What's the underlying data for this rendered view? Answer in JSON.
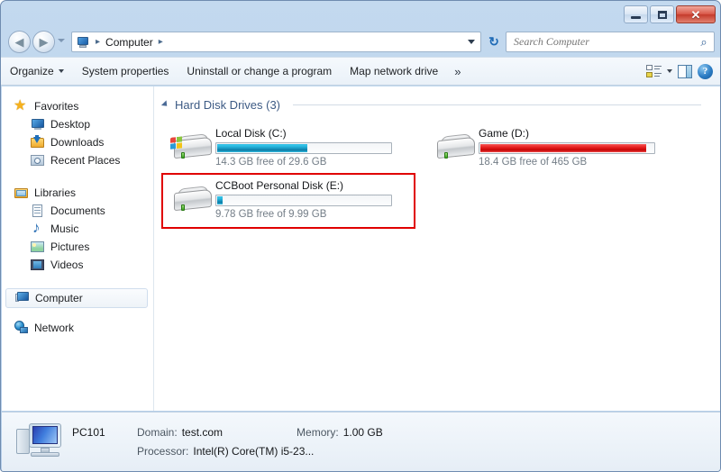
{
  "window": {
    "buttons": {
      "minimize": "minimize",
      "maximize": "maximize",
      "close": "✕"
    }
  },
  "nav_bar": {
    "back": "◀",
    "forward": "▶",
    "refresh": "↻",
    "breadcrumb": {
      "root": "Computer",
      "separator": "▸"
    },
    "search": {
      "placeholder": "Search Computer",
      "value": "",
      "icon": "⌕"
    }
  },
  "toolbar": {
    "items": [
      {
        "label": "Organize",
        "has_caret": true
      },
      {
        "label": "System properties",
        "has_caret": false
      },
      {
        "label": "Uninstall or change a program",
        "has_caret": false
      },
      {
        "label": "Map network drive",
        "has_caret": false
      }
    ],
    "overflow": "»",
    "help_glyph": "?"
  },
  "sidebar": {
    "groups": [
      {
        "header": {
          "label": "Favorites",
          "icon": "star-icon"
        },
        "items": [
          {
            "label": "Desktop",
            "icon": "desktop-icon"
          },
          {
            "label": "Downloads",
            "icon": "downloads-icon"
          },
          {
            "label": "Recent Places",
            "icon": "recent-places-icon"
          }
        ]
      },
      {
        "header": {
          "label": "Libraries",
          "icon": "libraries-icon"
        },
        "items": [
          {
            "label": "Documents",
            "icon": "documents-icon"
          },
          {
            "label": "Music",
            "icon": "music-icon"
          },
          {
            "label": "Pictures",
            "icon": "pictures-icon"
          },
          {
            "label": "Videos",
            "icon": "videos-icon"
          }
        ]
      }
    ],
    "computer": {
      "label": "Computer",
      "icon": "computer-icon",
      "selected": true
    },
    "network": {
      "label": "Network",
      "icon": "network-icon",
      "selected": false
    }
  },
  "content": {
    "group_title": "Hard Disk Drives (3)",
    "drives": [
      {
        "name": "Local Disk (C:)",
        "free_text": "14.3 GB free of 29.6 GB",
        "used_percent": 52,
        "bar_color": "#1796c0",
        "bar_style": "blue",
        "has_windows_badge": true,
        "selected": false
      },
      {
        "name": "Game (D:)",
        "free_text": "18.4 GB free of 465 GB",
        "used_percent": 96,
        "bar_color": "#d80f0f",
        "bar_style": "red",
        "has_windows_badge": false,
        "selected": false
      },
      {
        "name": "CCBoot Personal Disk (E:)",
        "free_text": "9.78 GB free of 9.99 GB",
        "used_percent": 3,
        "bar_color": "#1796c0",
        "bar_style": "blue",
        "has_windows_badge": false,
        "selected": true
      }
    ],
    "selection_color": "#e00000"
  },
  "details": {
    "pc_name": "PC101",
    "domain_label": "Domain:",
    "domain_value": "test.com",
    "memory_label": "Memory:",
    "memory_value": "1.00 GB",
    "processor_label": "Processor:",
    "processor_value": "Intel(R) Core(TM) i5-23..."
  }
}
